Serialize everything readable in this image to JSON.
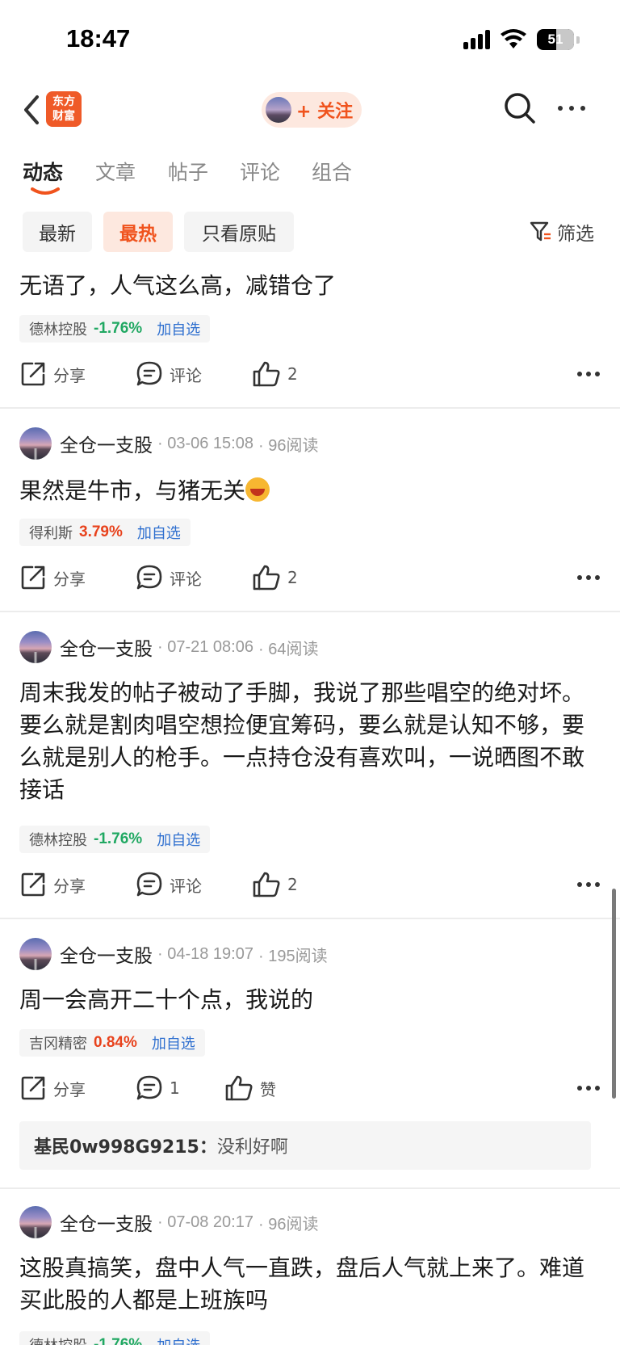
{
  "status_bar": {
    "time": "18:47",
    "battery": "51"
  },
  "nav": {
    "logo_line1": "东方",
    "logo_line2": "财富",
    "follow_label": "+ 关注"
  },
  "tabs": [
    {
      "label": "动态",
      "active": true
    },
    {
      "label": "文章"
    },
    {
      "label": "帖子"
    },
    {
      "label": "评论"
    },
    {
      "label": "组合"
    }
  ],
  "filters": {
    "options": [
      "最新",
      "最热",
      "只看原贴"
    ],
    "active": "最热",
    "filter_label": "筛选"
  },
  "actions": {
    "share": "分享",
    "comment": "评论",
    "like_default": "赞"
  },
  "posts": [
    {
      "text": "无语了，人气这么高，减错仓了",
      "stock": {
        "name": "德林控股",
        "pct": "-1.76%",
        "add": "加自选"
      },
      "comments": "评论",
      "likes": "2"
    },
    {
      "author": "全仓一支股",
      "date": "· 03-06 15:08",
      "reads": "· 96阅读",
      "text": "果然是牛市，与猪无关",
      "stock": {
        "name": "得利斯",
        "pct": "3.79%",
        "add": "加自选"
      },
      "comments": "评论",
      "likes": "2"
    },
    {
      "author": "全仓一支股",
      "date": "· 07-21 08:06",
      "reads": "· 64阅读",
      "text": "周末我发的帖子被动了手脚，我说了那些唱空的绝对坏。要么就是割肉唱空想捡便宜筹码，要么就是认知不够，要么就是别人的枪手。一点持仓没有喜欢叫，一说晒图不敢接话",
      "stock": {
        "name": "德林控股",
        "pct": "-1.76%",
        "add": "加自选"
      },
      "comments": "评论",
      "likes": "2"
    },
    {
      "author": "全仓一支股",
      "date": "· 04-18 19:07",
      "reads": "· 195阅读",
      "text": "周一会高开二十个点，我说的",
      "stock": {
        "name": "吉冈精密",
        "pct": "0.84%",
        "add": "加自选"
      },
      "comments": "1",
      "likes": "赞",
      "reply": {
        "user": "基民0w998G9215：",
        "text": "没利好啊"
      }
    },
    {
      "author": "全仓一支股",
      "date": "· 07-08 20:17",
      "reads": "· 96阅读",
      "text": "这股真搞笑，盘中人气一直跌，盘后人气就上来了。难道买此股的人都是上班族吗",
      "stock": {
        "name": "德林控股",
        "pct": "-1.76%",
        "add": "加自选"
      }
    }
  ]
}
